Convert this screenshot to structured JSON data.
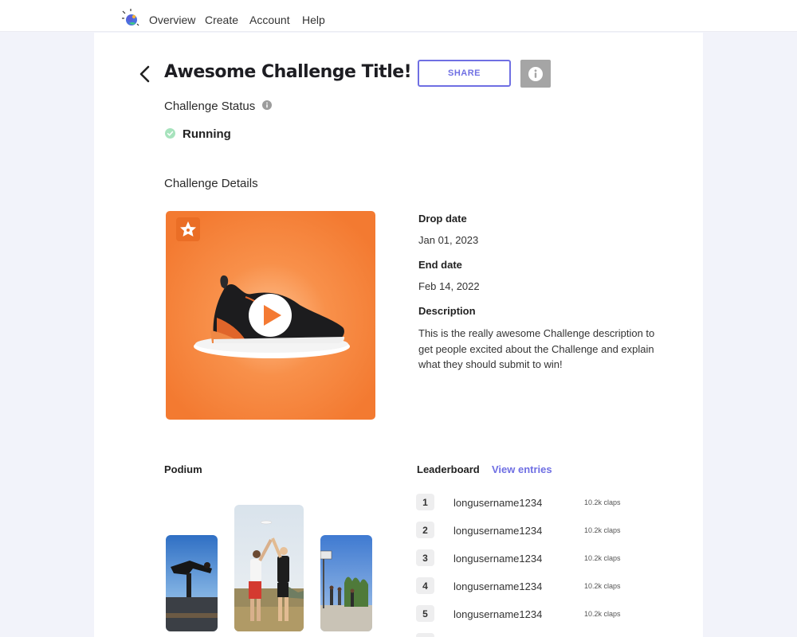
{
  "nav": {
    "items": [
      {
        "label": "Overview"
      },
      {
        "label": "Create"
      },
      {
        "label": "Account"
      },
      {
        "label": "Help"
      }
    ]
  },
  "header": {
    "title": "Awesome Challenge Title!",
    "share_label": "SHARE"
  },
  "status": {
    "label": "Challenge Status",
    "value": "Running",
    "color": "#9de0b4"
  },
  "details": {
    "heading": "Challenge Details",
    "drop_date_label": "Drop date",
    "drop_date": "Jan 01, 2023",
    "end_date_label": "End date",
    "end_date": "Feb 14, 2022",
    "description_label": "Description",
    "description": "This is the really awesome Challenge description to get people excited about the Challenge and explain what they should submit to win!"
  },
  "podium": {
    "heading": "Podium"
  },
  "leaderboard": {
    "heading": "Leaderboard",
    "view_entries": "View entries",
    "entries": [
      {
        "rank": "1",
        "username": "longusername1234",
        "claps": "10.2k claps"
      },
      {
        "rank": "2",
        "username": "longusername1234",
        "claps": "10.2k claps"
      },
      {
        "rank": "3",
        "username": "longusername1234",
        "claps": "10.2k claps"
      },
      {
        "rank": "4",
        "username": "longusername1234",
        "claps": "10.2k claps"
      },
      {
        "rank": "5",
        "username": "longusername1234",
        "claps": "10.2k claps"
      }
    ]
  },
  "colors": {
    "accent": "#6f6fe3",
    "media_orange": "#f47a33"
  }
}
